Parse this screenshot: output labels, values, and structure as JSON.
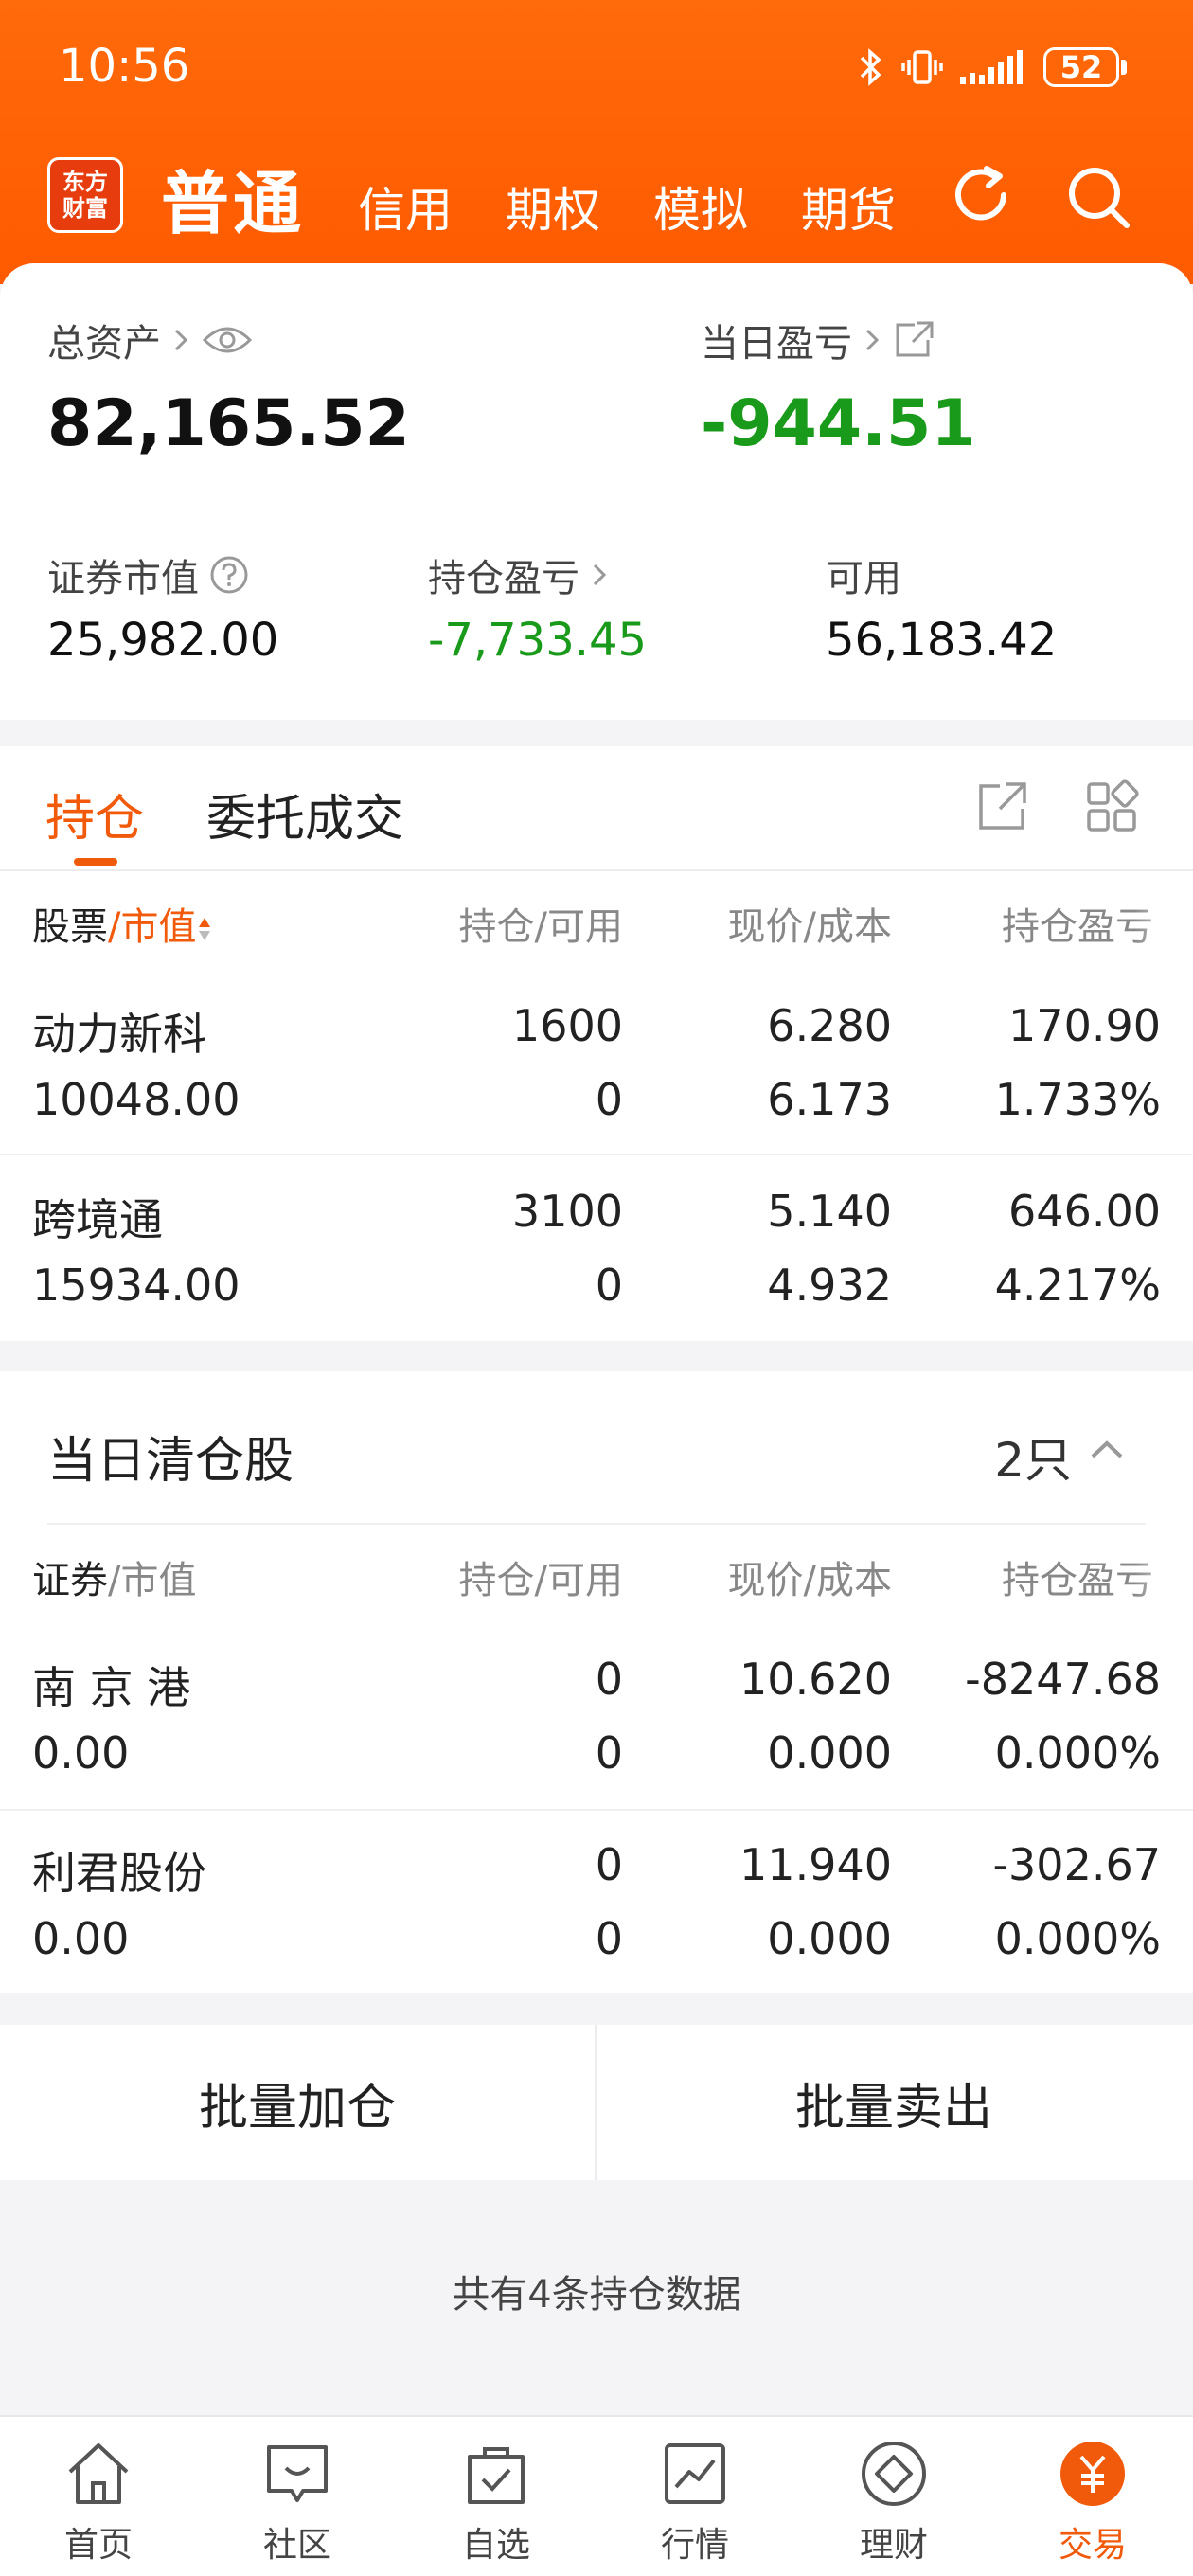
{
  "status": {
    "time": "10:56",
    "battery": "52"
  },
  "nav": {
    "logo_line1": "东方",
    "logo_line2": "财富",
    "active_tab": "普通",
    "tabs": [
      "信用",
      "期权",
      "模拟",
      "期货"
    ]
  },
  "summary": {
    "total_assets_label": "总资产",
    "total_assets": "82,165.52",
    "daily_pnl_label": "当日盈亏",
    "daily_pnl": "-944.51",
    "market_value_label": "证券市值",
    "market_value": "25,982.00",
    "position_pnl_label": "持仓盈亏",
    "position_pnl": "-7,733.45",
    "available_label": "可用",
    "available": "56,183.42"
  },
  "holdings": {
    "tab_active": "持仓",
    "tab_other": "委托成交",
    "col_stock": "股票",
    "col_sep": "/",
    "col_mv": "市值",
    "col_qty": "持仓/可用",
    "col_price": "现价/成本",
    "col_pnl": "持仓盈亏",
    "rows": [
      {
        "name": "动力新科",
        "mv": "10048.00",
        "qty": "1600",
        "avail": "0",
        "price": "6.280",
        "cost": "6.173",
        "pnl": "170.90",
        "pct": "1.733%"
      },
      {
        "name": "跨境通",
        "mv": "15934.00",
        "qty": "3100",
        "avail": "0",
        "price": "5.140",
        "cost": "4.932",
        "pnl": "646.00",
        "pct": "4.217%"
      }
    ]
  },
  "cleared": {
    "title": "当日清仓股",
    "count": "2只",
    "col_sec": "证券",
    "col_mv": "/市值",
    "col_qty": "持仓/可用",
    "col_price": "现价/成本",
    "col_pnl": "持仓盈亏",
    "rows": [
      {
        "name": "南 京 港",
        "mv": "0.00",
        "qty": "0",
        "avail": "0",
        "price": "10.620",
        "cost": "0.000",
        "pnl": "-8247.68",
        "pct": "0.000%"
      },
      {
        "name": "利君股份",
        "mv": "0.00",
        "qty": "0",
        "avail": "0",
        "price": "11.940",
        "cost": "0.000",
        "pnl": "-302.67",
        "pct": "0.000%"
      }
    ]
  },
  "batch": {
    "add": "批量加仓",
    "sell": "批量卖出"
  },
  "footer_note": "共有4条持仓数据",
  "bottom_nav": [
    "首页",
    "社区",
    "自选",
    "行情",
    "理财",
    "交易"
  ],
  "colors": {
    "brand": "#ff5a00",
    "up": "#e02b2b",
    "down": "#1a9a1a"
  }
}
